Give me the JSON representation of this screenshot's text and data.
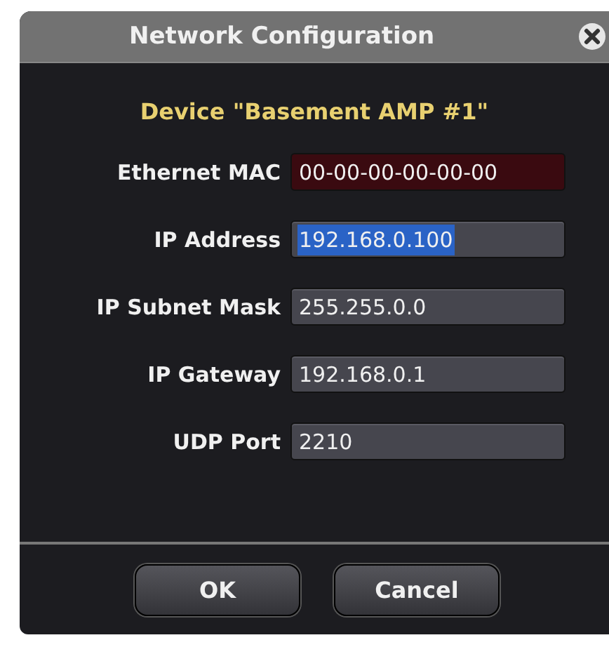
{
  "window": {
    "title": "Network Configuration"
  },
  "device_heading": "Device \"Basement AMP #1\"",
  "fields": [
    {
      "label": "Ethernet MAC",
      "value": "00-00-00-00-00-00",
      "kind": "readonly",
      "selected": false
    },
    {
      "label": "IP Address",
      "value": "192.168.0.100",
      "kind": "input",
      "selected": true
    },
    {
      "label": "IP Subnet Mask",
      "value": "255.255.0.0",
      "kind": "input",
      "selected": false
    },
    {
      "label": "IP Gateway",
      "value": "192.168.0.1",
      "kind": "input",
      "selected": false
    },
    {
      "label": "UDP Port",
      "value": "2210",
      "kind": "input",
      "selected": false
    }
  ],
  "buttons": [
    "OK",
    "Cancel"
  ]
}
